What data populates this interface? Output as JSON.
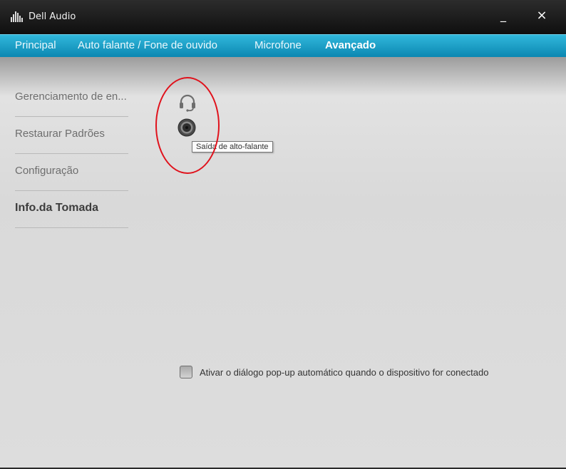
{
  "window": {
    "title": "Dell Audio",
    "minimize_glyph": "_",
    "close_glyph": "×"
  },
  "tabs": [
    {
      "label": "Principal",
      "active": false
    },
    {
      "label": "Auto falante / Fone de ouvido",
      "active": false
    },
    {
      "label": "Microfone",
      "active": false
    },
    {
      "label": "Avançado",
      "active": true
    }
  ],
  "sidebar": {
    "items": [
      {
        "label": "Gerenciamento de en...",
        "active": false
      },
      {
        "label": "Restaurar Padrões",
        "active": false
      },
      {
        "label": "Configuração",
        "active": false
      },
      {
        "label": "Info.da Tomada",
        "active": true
      }
    ]
  },
  "jacks": {
    "icons": [
      "headset-icon",
      "audio-jack-icon"
    ],
    "tooltip": "Saída de alto-falante",
    "highlight_color": "#e0121c"
  },
  "popup_option": {
    "label": "Ativar o diálogo pop-up automático quando o dispositivo for conectado",
    "checked": false
  },
  "colors": {
    "titlebar": "#1a1a1a",
    "tabbar": "#1fa3cc",
    "content": "#dcdcdc"
  }
}
